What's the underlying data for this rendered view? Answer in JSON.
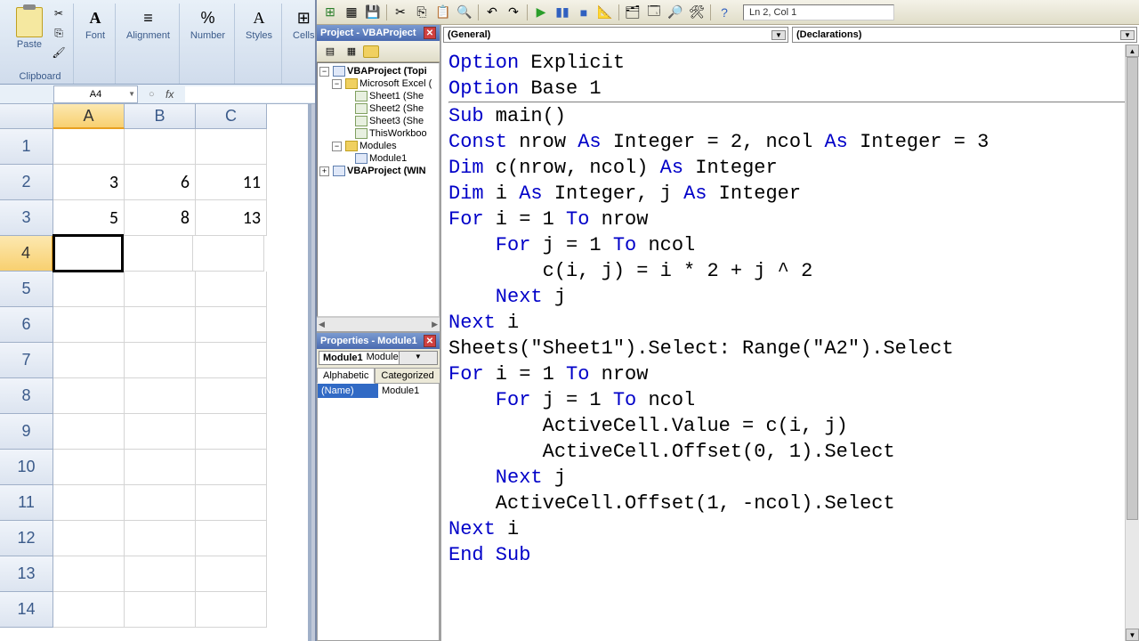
{
  "ribbon": {
    "clipboard_label": "Clipboard",
    "paste_label": "Paste",
    "font_label": "Font",
    "alignment_label": "Alignment",
    "number_label": "Number",
    "styles_label": "Styles",
    "cells_label": "Cells"
  },
  "namebox": {
    "value": "A4"
  },
  "grid": {
    "columns": [
      "A",
      "B",
      "C"
    ],
    "rows": [
      {
        "n": 1,
        "cells": [
          "",
          "",
          ""
        ]
      },
      {
        "n": 2,
        "cells": [
          "3",
          "6",
          "11"
        ]
      },
      {
        "n": 3,
        "cells": [
          "5",
          "8",
          "13"
        ]
      },
      {
        "n": 4,
        "cells": [
          "",
          "",
          ""
        ]
      },
      {
        "n": 5,
        "cells": [
          "",
          "",
          ""
        ]
      },
      {
        "n": 6,
        "cells": [
          "",
          "",
          ""
        ]
      },
      {
        "n": 7,
        "cells": [
          "",
          "",
          ""
        ]
      },
      {
        "n": 8,
        "cells": [
          "",
          "",
          ""
        ]
      },
      {
        "n": 9,
        "cells": [
          "",
          "",
          ""
        ]
      },
      {
        "n": 10,
        "cells": [
          "",
          "",
          ""
        ]
      },
      {
        "n": 11,
        "cells": [
          "",
          "",
          ""
        ]
      },
      {
        "n": 12,
        "cells": [
          "",
          "",
          ""
        ]
      },
      {
        "n": 13,
        "cells": [
          "",
          "",
          ""
        ]
      },
      {
        "n": 14,
        "cells": [
          "",
          "",
          ""
        ]
      }
    ],
    "active_row": 4,
    "active_col": "A"
  },
  "vbe": {
    "status": "Ln 2, Col 1",
    "project_title": "Project - VBAProject",
    "properties_title": "Properties - Module1",
    "properties_object": "Module1",
    "properties_type": "Module",
    "tabs": {
      "alpha": "Alphabetic",
      "cat": "Categorized"
    },
    "prop_name_key": "(Name)",
    "prop_name_val": "Module1",
    "tree": {
      "root1": "VBAProject (Topi",
      "excel_objs": "Microsoft Excel (",
      "sheet1": "Sheet1 (She",
      "sheet2": "Sheet2 (She",
      "sheet3": "Sheet3 (She",
      "thiswb": "ThisWorkboo",
      "modules": "Modules",
      "module1": "Module1",
      "root2": "VBAProject (WIN"
    },
    "dd_left": "(General)",
    "dd_right": "(Declarations)",
    "code": {
      "l1a": "Option",
      "l1b": " Explicit",
      "l2a": "Option",
      "l2b": " Base 1",
      "l3a": "Sub",
      "l3b": " main()",
      "l4a": "Const",
      "l4b": " nrow ",
      "l4c": "As",
      "l4d": " Integer = 2, ncol ",
      "l4e": "As",
      "l4f": " Integer = 3",
      "l5a": "Dim",
      "l5b": " c(nrow, ncol) ",
      "l5c": "As",
      "l5d": " Integer",
      "l6a": "Dim",
      "l6b": " i ",
      "l6c": "As",
      "l6d": " Integer, j ",
      "l6e": "As",
      "l6f": " Integer",
      "l7a": "For",
      "l7b": " i = 1 ",
      "l7c": "To",
      "l7d": " nrow",
      "l8a": "    For",
      "l8b": " j = 1 ",
      "l8c": "To",
      "l8d": " ncol",
      "l9": "        c(i, j) = i * 2 + j ^ 2",
      "l10a": "    Next",
      "l10b": " j",
      "l11a": "Next",
      "l11b": " i",
      "l12": "Sheets(\"Sheet1\").Select: Range(\"A2\").Select",
      "l13a": "For",
      "l13b": " i = 1 ",
      "l13c": "To",
      "l13d": " nrow",
      "l14a": "    For",
      "l14b": " j = 1 ",
      "l14c": "To",
      "l14d": " ncol",
      "l15": "        ActiveCell.Value = c(i, j)",
      "l16": "        ActiveCell.Offset(0, 1).Select",
      "l17a": "    Next",
      "l17b": " j",
      "l18": "    ActiveCell.Offset(1, -ncol).Select",
      "l19a": "Next",
      "l19b": " i",
      "l20": "End Sub"
    }
  }
}
